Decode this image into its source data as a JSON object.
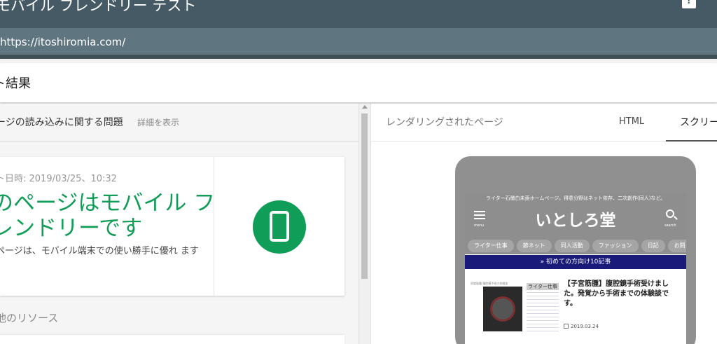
{
  "app": {
    "title": "モバイル フレンドリー テスト"
  },
  "url_bar": {
    "url": "https://itoshiromia.com/"
  },
  "results": {
    "title": "ト結果"
  },
  "left_panel": {
    "issues_text": "ージの読み込みに関する問題",
    "details_link": "詳細を表示",
    "test_date": "ト日時: 2019/03/25、10:32",
    "result_heading": "のページはモバイル フレンドリーです",
    "result_description": "ページは、モバイル端末での使い勝手に優れ ます",
    "result_icon": "smartphone-icon",
    "other_resources": "他のリソース"
  },
  "right_panel": {
    "rendered_label": "レンダリングされたページ",
    "tabs": [
      {
        "label": "HTML",
        "active": false
      },
      {
        "label": "スクリー",
        "active": true
      }
    ]
  },
  "preview": {
    "tagline": "ライター石黴白未亜ホームページ。得意分野はネット依存、二次創作(同人)など。",
    "menu_label": "menu",
    "site_name": "いとしろ堂",
    "search_label": "search",
    "categories": [
      "ライター仕事",
      "節ネット",
      "同人活動",
      "ファッション",
      "日記",
      "お問"
    ],
    "cta": "» 初めての方向け10記事",
    "article": {
      "thumb_caption": "卵巣脳腫 腹腔鏡手術の体験談",
      "thumb_tag": "ライター仕事",
      "title": "【子宮筋腫】腹腔鏡手術受けました。発覚から手術までの体験談です。",
      "date": "2019.03.24"
    }
  },
  "colors": {
    "title_bar": "#455a64",
    "accent_green": "#0f9d58",
    "cta_bar": "#1a1a7a"
  }
}
